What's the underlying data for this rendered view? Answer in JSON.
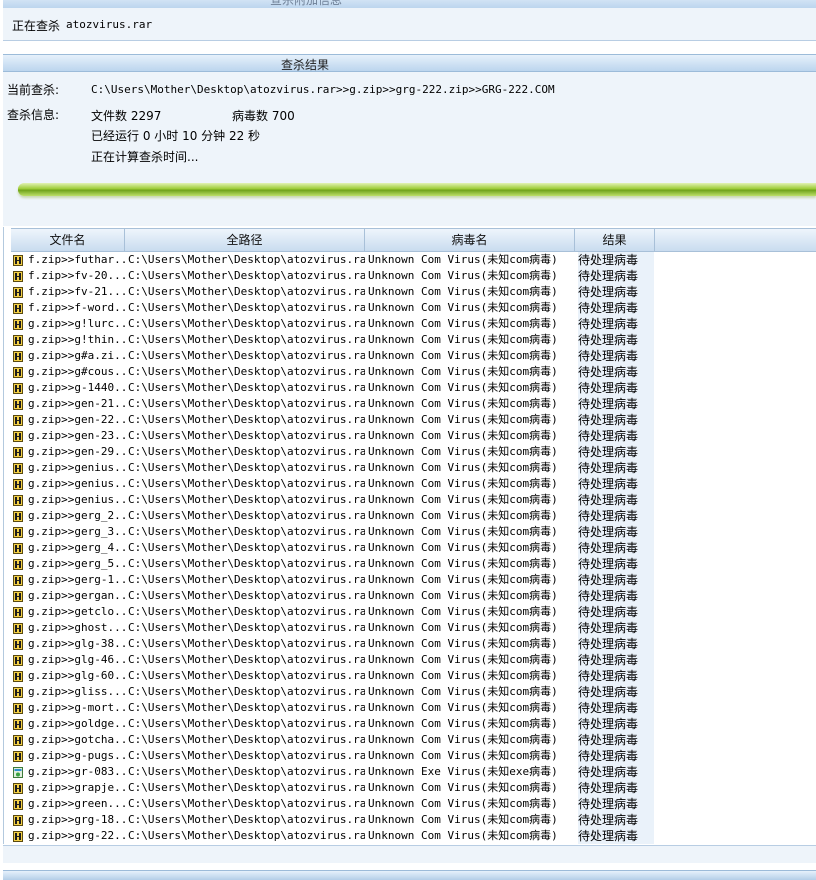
{
  "top_section": {
    "title": "查杀附加信息"
  },
  "scanning": {
    "label": "正在查杀",
    "file": "atozvirus.rar"
  },
  "results_section": {
    "title": "查杀结果"
  },
  "current": {
    "label": "当前查杀:",
    "path": "C:\\Users\\Mother\\Desktop\\atozvirus.rar>>g.zip>>grg-222.zip>>GRG-222.COM"
  },
  "info": {
    "label": "查杀信息:",
    "files_label": "文件数 2297",
    "virus_label": "病毒数 700",
    "elapsed": "已经运行 0 小时 10 分钟 22  秒",
    "estimating": "正在计算查杀时间..."
  },
  "progress": {
    "fraction": 1.0
  },
  "table": {
    "columns": [
      "文件名",
      "全路径",
      "病毒名",
      "结果"
    ],
    "rows": [
      {
        "icon": "com-file-icon",
        "name": "f.zip>>futhar...",
        "path": "C:\\Users\\Mother\\Desktop\\atozvirus.ra...",
        "virus": "Unknown Com Virus(未知com病毒)",
        "result": "待处理病毒"
      },
      {
        "icon": "com-file-icon",
        "name": "f.zip>>fv-20...",
        "path": "C:\\Users\\Mother\\Desktop\\atozvirus.ra...",
        "virus": "Unknown Com Virus(未知com病毒)",
        "result": "待处理病毒"
      },
      {
        "icon": "com-file-icon",
        "name": "f.zip>>fv-21...",
        "path": "C:\\Users\\Mother\\Desktop\\atozvirus.ra...",
        "virus": "Unknown Com Virus(未知com病毒)",
        "result": "待处理病毒"
      },
      {
        "icon": "com-file-icon",
        "name": "f.zip>>f-word...",
        "path": "C:\\Users\\Mother\\Desktop\\atozvirus.ra...",
        "virus": "Unknown Com Virus(未知com病毒)",
        "result": "待处理病毒"
      },
      {
        "icon": "com-file-icon",
        "name": "g.zip>>g!lurc...",
        "path": "C:\\Users\\Mother\\Desktop\\atozvirus.ra...",
        "virus": "Unknown Com Virus(未知com病毒)",
        "result": "待处理病毒"
      },
      {
        "icon": "com-file-icon",
        "name": "g.zip>>g!thin...",
        "path": "C:\\Users\\Mother\\Desktop\\atozvirus.ra...",
        "virus": "Unknown Com Virus(未知com病毒)",
        "result": "待处理病毒"
      },
      {
        "icon": "com-file-icon",
        "name": "g.zip>>g#a.zi...",
        "path": "C:\\Users\\Mother\\Desktop\\atozvirus.ra...",
        "virus": "Unknown Com Virus(未知com病毒)",
        "result": "待处理病毒"
      },
      {
        "icon": "com-file-icon",
        "name": "g.zip>>g#cous...",
        "path": "C:\\Users\\Mother\\Desktop\\atozvirus.ra...",
        "virus": "Unknown Com Virus(未知com病毒)",
        "result": "待处理病毒"
      },
      {
        "icon": "com-file-icon",
        "name": "g.zip>>g-1440...",
        "path": "C:\\Users\\Mother\\Desktop\\atozvirus.ra...",
        "virus": "Unknown Com Virus(未知com病毒)",
        "result": "待处理病毒"
      },
      {
        "icon": "com-file-icon",
        "name": "g.zip>>gen-21...",
        "path": "C:\\Users\\Mother\\Desktop\\atozvirus.ra...",
        "virus": "Unknown Com Virus(未知com病毒)",
        "result": "待处理病毒"
      },
      {
        "icon": "com-file-icon",
        "name": "g.zip>>gen-22...",
        "path": "C:\\Users\\Mother\\Desktop\\atozvirus.ra...",
        "virus": "Unknown Com Virus(未知com病毒)",
        "result": "待处理病毒"
      },
      {
        "icon": "com-file-icon",
        "name": "g.zip>>gen-23...",
        "path": "C:\\Users\\Mother\\Desktop\\atozvirus.ra...",
        "virus": "Unknown Com Virus(未知com病毒)",
        "result": "待处理病毒"
      },
      {
        "icon": "com-file-icon",
        "name": "g.zip>>gen-29...",
        "path": "C:\\Users\\Mother\\Desktop\\atozvirus.ra...",
        "virus": "Unknown Com Virus(未知com病毒)",
        "result": "待处理病毒"
      },
      {
        "icon": "com-file-icon",
        "name": "g.zip>>genius...",
        "path": "C:\\Users\\Mother\\Desktop\\atozvirus.ra...",
        "virus": "Unknown Com Virus(未知com病毒)",
        "result": "待处理病毒"
      },
      {
        "icon": "com-file-icon",
        "name": "g.zip>>genius...",
        "path": "C:\\Users\\Mother\\Desktop\\atozvirus.ra...",
        "virus": "Unknown Com Virus(未知com病毒)",
        "result": "待处理病毒"
      },
      {
        "icon": "com-file-icon",
        "name": "g.zip>>genius...",
        "path": "C:\\Users\\Mother\\Desktop\\atozvirus.ra...",
        "virus": "Unknown Com Virus(未知com病毒)",
        "result": "待处理病毒"
      },
      {
        "icon": "com-file-icon",
        "name": "g.zip>>gerg_2...",
        "path": "C:\\Users\\Mother\\Desktop\\atozvirus.ra...",
        "virus": "Unknown Com Virus(未知com病毒)",
        "result": "待处理病毒"
      },
      {
        "icon": "com-file-icon",
        "name": "g.zip>>gerg_3...",
        "path": "C:\\Users\\Mother\\Desktop\\atozvirus.ra...",
        "virus": "Unknown Com Virus(未知com病毒)",
        "result": "待处理病毒"
      },
      {
        "icon": "com-file-icon",
        "name": "g.zip>>gerg_4...",
        "path": "C:\\Users\\Mother\\Desktop\\atozvirus.ra...",
        "virus": "Unknown Com Virus(未知com病毒)",
        "result": "待处理病毒"
      },
      {
        "icon": "com-file-icon",
        "name": "g.zip>>gerg_5...",
        "path": "C:\\Users\\Mother\\Desktop\\atozvirus.ra...",
        "virus": "Unknown Com Virus(未知com病毒)",
        "result": "待处理病毒"
      },
      {
        "icon": "com-file-icon",
        "name": "g.zip>>gerg-1...",
        "path": "C:\\Users\\Mother\\Desktop\\atozvirus.ra...",
        "virus": "Unknown Com Virus(未知com病毒)",
        "result": "待处理病毒"
      },
      {
        "icon": "com-file-icon",
        "name": "g.zip>>gergan...",
        "path": "C:\\Users\\Mother\\Desktop\\atozvirus.ra...",
        "virus": "Unknown Com Virus(未知com病毒)",
        "result": "待处理病毒"
      },
      {
        "icon": "com-file-icon",
        "name": "g.zip>>getclo...",
        "path": "C:\\Users\\Mother\\Desktop\\atozvirus.ra...",
        "virus": "Unknown Com Virus(未知com病毒)",
        "result": "待处理病毒"
      },
      {
        "icon": "com-file-icon",
        "name": "g.zip>>ghost...",
        "path": "C:\\Users\\Mother\\Desktop\\atozvirus.ra...",
        "virus": "Unknown Com Virus(未知com病毒)",
        "result": "待处理病毒"
      },
      {
        "icon": "com-file-icon",
        "name": "g.zip>>glg-38...",
        "path": "C:\\Users\\Mother\\Desktop\\atozvirus.ra...",
        "virus": "Unknown Com Virus(未知com病毒)",
        "result": "待处理病毒"
      },
      {
        "icon": "com-file-icon",
        "name": "g.zip>>glg-46...",
        "path": "C:\\Users\\Mother\\Desktop\\atozvirus.ra...",
        "virus": "Unknown Com Virus(未知com病毒)",
        "result": "待处理病毒"
      },
      {
        "icon": "com-file-icon",
        "name": "g.zip>>glg-60...",
        "path": "C:\\Users\\Mother\\Desktop\\atozvirus.ra...",
        "virus": "Unknown Com Virus(未知com病毒)",
        "result": "待处理病毒"
      },
      {
        "icon": "com-file-icon",
        "name": "g.zip>>gliss...",
        "path": "C:\\Users\\Mother\\Desktop\\atozvirus.ra...",
        "virus": "Unknown Com Virus(未知com病毒)",
        "result": "待处理病毒"
      },
      {
        "icon": "com-file-icon",
        "name": "g.zip>>g-mort...",
        "path": "C:\\Users\\Mother\\Desktop\\atozvirus.ra...",
        "virus": "Unknown Com Virus(未知com病毒)",
        "result": "待处理病毒"
      },
      {
        "icon": "com-file-icon",
        "name": "g.zip>>goldge...",
        "path": "C:\\Users\\Mother\\Desktop\\atozvirus.ra...",
        "virus": "Unknown Com Virus(未知com病毒)",
        "result": "待处理病毒"
      },
      {
        "icon": "com-file-icon",
        "name": "g.zip>>gotcha...",
        "path": "C:\\Users\\Mother\\Desktop\\atozvirus.ra...",
        "virus": "Unknown Com Virus(未知com病毒)",
        "result": "待处理病毒"
      },
      {
        "icon": "com-file-icon",
        "name": "g.zip>>g-pugs...",
        "path": "C:\\Users\\Mother\\Desktop\\atozvirus.ra...",
        "virus": "Unknown Com Virus(未知com病毒)",
        "result": "待处理病毒"
      },
      {
        "icon": "exe-file-icon",
        "name": "g.zip>>gr-083...",
        "path": "C:\\Users\\Mother\\Desktop\\atozvirus.ra...",
        "virus": "Unknown Exe Virus(未知exe病毒)",
        "result": "待处理病毒"
      },
      {
        "icon": "com-file-icon",
        "name": "g.zip>>grapje...",
        "path": "C:\\Users\\Mother\\Desktop\\atozvirus.ra...",
        "virus": "Unknown Com Virus(未知com病毒)",
        "result": "待处理病毒"
      },
      {
        "icon": "com-file-icon",
        "name": "g.zip>>green...",
        "path": "C:\\Users\\Mother\\Desktop\\atozvirus.ra...",
        "virus": "Unknown Com Virus(未知com病毒)",
        "result": "待处理病毒"
      },
      {
        "icon": "com-file-icon",
        "name": "g.zip>>grg-18...",
        "path": "C:\\Users\\Mother\\Desktop\\atozvirus.ra...",
        "virus": "Unknown Com Virus(未知com病毒)",
        "result": "待处理病毒"
      },
      {
        "icon": "com-file-icon",
        "name": "g.zip>>grg-22...",
        "path": "C:\\Users\\Mother\\Desktop\\atozvirus.ra...",
        "virus": "Unknown Com Virus(未知com病毒)",
        "result": "待处理病毒"
      }
    ]
  }
}
